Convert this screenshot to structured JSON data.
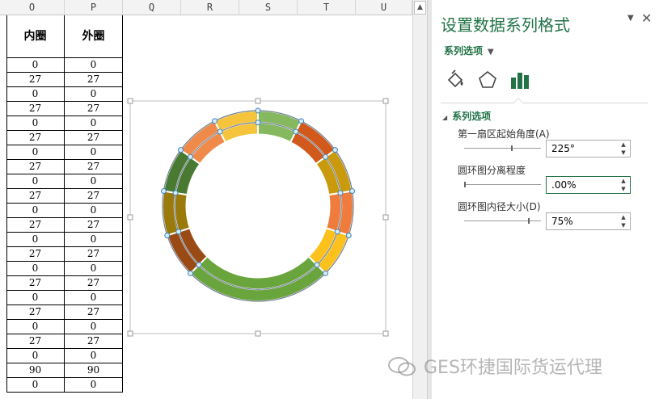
{
  "sheet": {
    "columns": [
      "O",
      "P",
      "Q",
      "R",
      "S",
      "T",
      "U"
    ],
    "table_header": [
      "内圈",
      "外圈"
    ],
    "inner_values": [
      "0",
      "27",
      "0",
      "27",
      "0",
      "27",
      "0",
      "27",
      "0",
      "27",
      "0",
      "27",
      "0",
      "27",
      "0",
      "27",
      "0",
      "27",
      "0",
      "27",
      "0",
      "90",
      "0"
    ],
    "outer_values": [
      "0",
      "27",
      "0",
      "27",
      "0",
      "27",
      "0",
      "27",
      "0",
      "27",
      "0",
      "27",
      "0",
      "27",
      "0",
      "27",
      "0",
      "27",
      "0",
      "27",
      "0",
      "90",
      "0"
    ]
  },
  "chart_data": {
    "type": "doughnut",
    "first_slice_angle_deg": 225,
    "hole_size_percent": 75,
    "explosion_percent": 0,
    "series": [
      {
        "name": "内圈",
        "values": [
          0,
          27,
          0,
          27,
          0,
          27,
          0,
          27,
          0,
          27,
          0,
          27,
          0,
          27,
          0,
          27,
          0,
          27,
          0,
          27,
          0,
          90,
          0
        ]
      },
      {
        "name": "外圈",
        "values": [
          0,
          27,
          0,
          27,
          0,
          27,
          0,
          27,
          0,
          27,
          0,
          27,
          0,
          27,
          0,
          27,
          0,
          27,
          0,
          27,
          0,
          90,
          0
        ]
      }
    ],
    "slice_colors": [
      "#9a4a14",
      "#9a7a0a",
      "#4a7a32",
      "#ef8a4a",
      "#f6c43c",
      "#86b860",
      "#d2591c",
      "#c99a0e",
      "#ef7c3c",
      "#fcc11c",
      "#6aa43c"
    ]
  },
  "pane": {
    "title": "设置数据系列格式",
    "series_options_tab": "系列选项",
    "icons": [
      "fill-line-icon",
      "effects-pentagon-icon",
      "series-options-bars-icon"
    ],
    "section_title": "系列选项",
    "first_slice_angle": {
      "label": "第一扇区起始角度(A)",
      "value": "225°",
      "level_percent": 62
    },
    "explosion": {
      "label": "圆环图分离程度",
      "value": ".00%",
      "level_percent": 0
    },
    "hole_size": {
      "label": "圆环图内径大小(D)",
      "value": "75%",
      "level_percent": 85
    }
  },
  "watermark": "GES环捷国际货运代理"
}
